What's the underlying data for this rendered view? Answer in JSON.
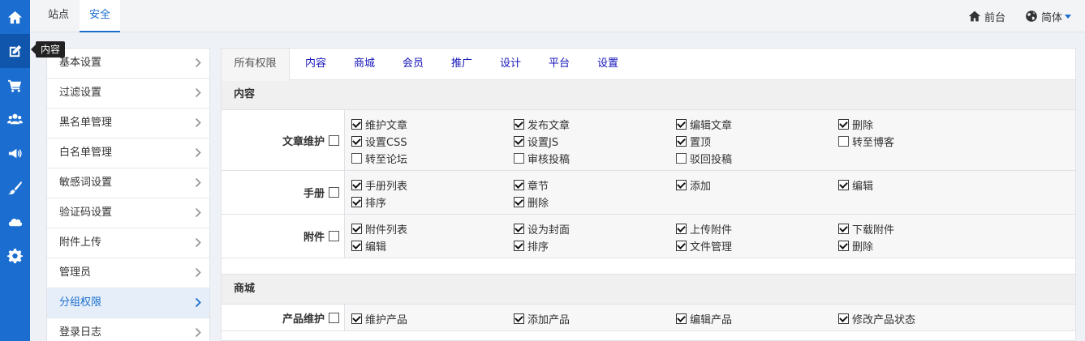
{
  "topbar": {
    "tabs": [
      "站点",
      "安全"
    ],
    "frontend_label": "前台",
    "language_label": "简体"
  },
  "tooltip": "内容",
  "rail_icons": [
    "home-icon",
    "edit-icon",
    "cart-icon",
    "users-icon",
    "megaphone-icon",
    "brush-icon",
    "cloud-icon",
    "gear-icon"
  ],
  "submenu": {
    "items": [
      "基本设置",
      "过滤设置",
      "黑名单管理",
      "白名单管理",
      "敏感词设置",
      "验证码设置",
      "附件上传",
      "管理员",
      "分组权限",
      "登录日志"
    ],
    "active_index": 8
  },
  "tabs": [
    "所有权限",
    "内容",
    "商城",
    "会员",
    "推广",
    "设计",
    "平台",
    "设置"
  ],
  "sections": [
    {
      "title": "内容",
      "rows": [
        {
          "label": "文章维护",
          "checked": false,
          "perms": [
            {
              "label": "维护文章",
              "checked": true
            },
            {
              "label": "发布文章",
              "checked": true
            },
            {
              "label": "编辑文章",
              "checked": true
            },
            {
              "label": "删除",
              "checked": true
            },
            {
              "label": "设置CSS",
              "checked": true
            },
            {
              "label": "设置JS",
              "checked": true
            },
            {
              "label": "置顶",
              "checked": true
            },
            {
              "label": "转至博客",
              "checked": false
            },
            {
              "label": "转至论坛",
              "checked": false
            },
            {
              "label": "审核投稿",
              "checked": false
            },
            {
              "label": "驳回投稿",
              "checked": false
            }
          ]
        },
        {
          "label": "手册",
          "checked": false,
          "perms": [
            {
              "label": "手册列表",
              "checked": true
            },
            {
              "label": "章节",
              "checked": true
            },
            {
              "label": "添加",
              "checked": true
            },
            {
              "label": "编辑",
              "checked": true
            },
            {
              "label": "排序",
              "checked": true
            },
            {
              "label": "删除",
              "checked": true
            }
          ]
        },
        {
          "label": "附件",
          "checked": false,
          "perms": [
            {
              "label": "附件列表",
              "checked": true
            },
            {
              "label": "设为封面",
              "checked": true
            },
            {
              "label": "上传附件",
              "checked": true
            },
            {
              "label": "下载附件",
              "checked": true
            },
            {
              "label": "编辑",
              "checked": true
            },
            {
              "label": "排序",
              "checked": true
            },
            {
              "label": "文件管理",
              "checked": true
            },
            {
              "label": "删除",
              "checked": true
            }
          ]
        }
      ]
    },
    {
      "title": "商城",
      "rows": [
        {
          "label": "产品维护",
          "checked": false,
          "perms": [
            {
              "label": "维护产品",
              "checked": true
            },
            {
              "label": "添加产品",
              "checked": true
            },
            {
              "label": "编辑产品",
              "checked": true
            },
            {
              "label": "修改产品状态",
              "checked": true
            }
          ]
        }
      ]
    }
  ]
}
